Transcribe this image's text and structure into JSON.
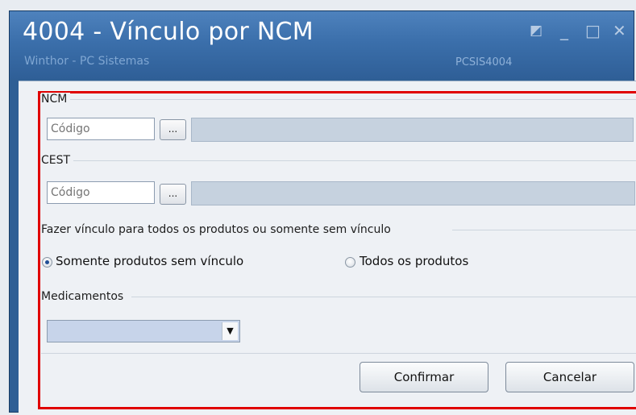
{
  "window": {
    "title": "4004 - Vínculo por NCM",
    "subtitle": "Winthor - PC Sistemas",
    "program_code": "PCSIS4004",
    "controls": {
      "restore": "◩",
      "minimize": "_",
      "maximize": "□",
      "close": "✕"
    }
  },
  "ncm": {
    "label": "NCM",
    "code_placeholder": "Código",
    "lookup_label": "..."
  },
  "cest": {
    "label": "CEST",
    "code_placeholder": "Código",
    "lookup_label": "..."
  },
  "vinculo": {
    "label": "Fazer vínculo para todos os produtos ou somente sem vínculo",
    "option_sem_vinculo": "Somente produtos sem vínculo",
    "option_todos": "Todos os produtos",
    "selected": "Somente produtos sem vínculo"
  },
  "medicamentos": {
    "label": "Medicamentos",
    "selected_value": ""
  },
  "buttons": {
    "confirm": "Confirmar",
    "cancel": "Cancelar"
  },
  "colors": {
    "titlebar": "#3b6fab",
    "highlight_frame": "#e00000",
    "desc_field": "#c6d2df"
  }
}
